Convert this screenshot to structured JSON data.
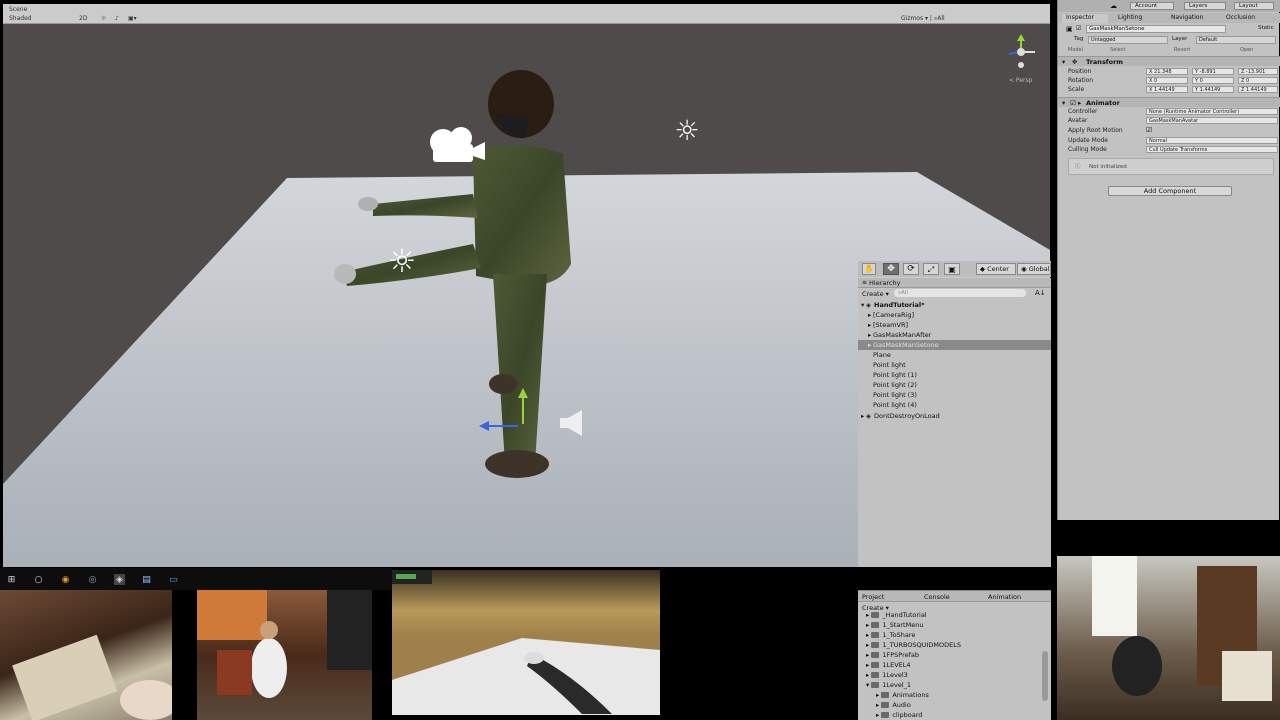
{
  "scene": {
    "tab_label": "Scene",
    "shading_mode": "Shaded",
    "mode_2d": "2D",
    "gizmos": "Gizmos ▾ | ⌕All",
    "persp_label": "< Persp"
  },
  "inspector": {
    "tabs": [
      "Inspector",
      "Lighting",
      "Navigation",
      "Occlusion"
    ],
    "top_buttons": [
      "Account",
      "Layers",
      "Layout"
    ],
    "object_name": "GasMaskManSetone",
    "static_label": "Static",
    "tag_label": "Tag",
    "tag_value": "Untagged",
    "layer_label": "Layer",
    "layer_value": "Default",
    "prefab_buttons": [
      "Model",
      "Select",
      "Revert",
      "Open"
    ],
    "transform": {
      "title": "Transform",
      "position_label": "Position",
      "rotation_label": "Rotation",
      "scale_label": "Scale",
      "position": [
        "X 21.348",
        "Y -8.891",
        "Z -13.901"
      ],
      "rotation": [
        "X 0",
        "Y 0",
        "Z 0"
      ],
      "scale": [
        "X 1.44149",
        "Y 1.44149",
        "Z 1.44149"
      ]
    },
    "animator": {
      "title": "Animator",
      "controller_label": "Controller",
      "controller_value": "None (Runtime Animator Controller)",
      "avatar_label": "Avatar",
      "avatar_value": "GasMaskManAvatar",
      "root_motion_label": "Apply Root Motion",
      "update_mode_label": "Update Mode",
      "update_mode_value": "Normal",
      "culling_mode_label": "Culling Mode",
      "culling_mode_value": "Cull Update Transforms"
    },
    "info_text": "Not initialized",
    "add_component": "Add Component"
  },
  "hierarchy_toolbar": {
    "center": "Center",
    "global": "Global"
  },
  "hierarchy": {
    "title": "Hierarchy",
    "create": "Create ▾",
    "search_placeholder": "⌕All",
    "scene_name": "HandTutorial*",
    "items": [
      {
        "label": "[CameraRig]",
        "indent": 2,
        "arrow": true,
        "selected": false
      },
      {
        "label": "[SteamVR]",
        "indent": 2,
        "arrow": true,
        "selected": false
      },
      {
        "label": "GasMaskManAfter",
        "indent": 2,
        "arrow": true,
        "selected": false
      },
      {
        "label": "GasMaskManSetone",
        "indent": 2,
        "arrow": true,
        "selected": true
      },
      {
        "label": "Plane",
        "indent": 2,
        "arrow": false,
        "selected": false
      },
      {
        "label": "Point light",
        "indent": 2,
        "arrow": false,
        "selected": false
      },
      {
        "label": "Point light (1)",
        "indent": 2,
        "arrow": false,
        "selected": false
      },
      {
        "label": "Point light (2)",
        "indent": 2,
        "arrow": false,
        "selected": false
      },
      {
        "label": "Point light (3)",
        "indent": 2,
        "arrow": false,
        "selected": false
      },
      {
        "label": "Point light (4)",
        "indent": 2,
        "arrow": false,
        "selected": false
      }
    ],
    "dont_destroy": "DontDestroyOnLoad"
  },
  "project": {
    "tabs": [
      "Project",
      "Console",
      "Animation"
    ],
    "create": "Create ▾",
    "items": [
      {
        "label": "_HandTutorial",
        "level": 1
      },
      {
        "label": "1_StartMenu",
        "level": 1
      },
      {
        "label": "1_ToShare",
        "level": 1
      },
      {
        "label": "1_TURBOSQUIDMODELS",
        "level": 1
      },
      {
        "label": "1FPSPrefab",
        "level": 1
      },
      {
        "label": "1LEVEL4",
        "level": 1
      },
      {
        "label": "1Level3",
        "level": 1
      },
      {
        "label": "1Level_1",
        "level": 1
      },
      {
        "label": "Animations",
        "level": 2
      },
      {
        "label": "Audio",
        "level": 2
      },
      {
        "label": "clipboard",
        "level": 2
      }
    ]
  },
  "colors": {
    "unity_panel": "#c2c2c2",
    "scene_wall": "#4e4b4a",
    "floor": "#b9bfc6",
    "selection": "#8a8a8a"
  }
}
